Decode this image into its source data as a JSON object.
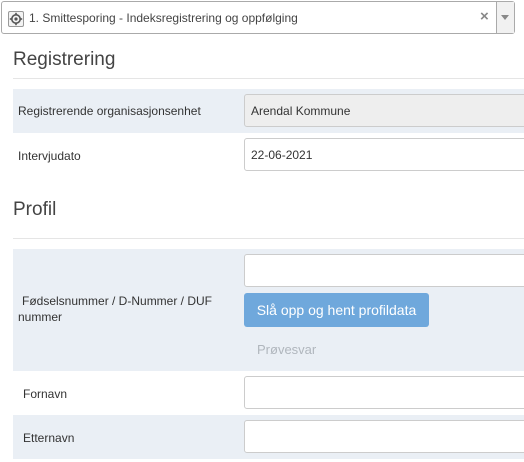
{
  "program": {
    "selected": "1. Smittesporing - Indeksregistrering og oppfølging",
    "clear_symbol": "×",
    "icon": "gear-icon"
  },
  "registration": {
    "title": "Registrering",
    "org_unit_label": "Registrerende organisasjonsenhet",
    "org_unit_value": "Arendal Kommune",
    "interview_date_label": "Intervjudato",
    "interview_date_value": "22-06-2021"
  },
  "profile": {
    "title": "Profil",
    "id_number_label": "Fødselsnummer / D-Nummer / DUF nummer",
    "id_number_value": "",
    "lookup_button": "Slå opp og hent profildata",
    "test_result_link": "Prøvesvar",
    "first_name_label": "Fornavn",
    "first_name_value": "",
    "last_name_label": "Etternavn",
    "last_name_value": ""
  },
  "colors": {
    "shaded_row": "#eaeff5",
    "primary_button": "#6fa8dc"
  }
}
